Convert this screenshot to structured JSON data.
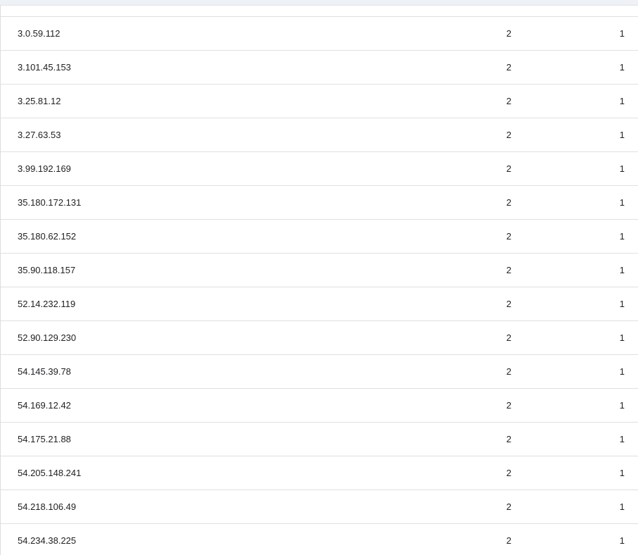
{
  "table": {
    "rows": [
      {
        "ip": "3.0.59.112",
        "a": "2",
        "b": "1"
      },
      {
        "ip": "3.101.45.153",
        "a": "2",
        "b": "1"
      },
      {
        "ip": "3.25.81.12",
        "a": "2",
        "b": "1"
      },
      {
        "ip": "3.27.63.53",
        "a": "2",
        "b": "1"
      },
      {
        "ip": "3.99.192.169",
        "a": "2",
        "b": "1"
      },
      {
        "ip": "35.180.172.131",
        "a": "2",
        "b": "1"
      },
      {
        "ip": "35.180.62.152",
        "a": "2",
        "b": "1"
      },
      {
        "ip": "35.90.118.157",
        "a": "2",
        "b": "1"
      },
      {
        "ip": "52.14.232.119",
        "a": "2",
        "b": "1"
      },
      {
        "ip": "52.90.129.230",
        "a": "2",
        "b": "1"
      },
      {
        "ip": "54.145.39.78",
        "a": "2",
        "b": "1"
      },
      {
        "ip": "54.169.12.42",
        "a": "2",
        "b": "1"
      },
      {
        "ip": "54.175.21.88",
        "a": "2",
        "b": "1"
      },
      {
        "ip": "54.205.148.241",
        "a": "2",
        "b": "1"
      },
      {
        "ip": "54.218.106.49",
        "a": "2",
        "b": "1"
      },
      {
        "ip": "54.234.38.225",
        "a": "2",
        "b": "1"
      }
    ]
  }
}
